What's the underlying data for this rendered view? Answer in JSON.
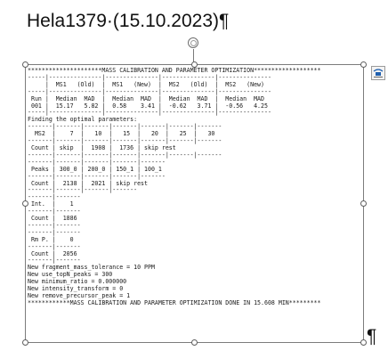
{
  "document": {
    "title": "Hela1379·(15.10.2023)¶",
    "end_mark": "¶"
  },
  "image": {
    "lines": [
      "*********************MASS CALIBRATION AND PARAMETER OPTIMIZATION*******************",
      "-----|---------------|---------------|---------------|---------------",
      "     |  MS1   (Old)  |  MS1   (New)  |  MS2   (Old)  |  MS2   (New)",
      "-----|---------------|---------------|---------------|---------------",
      " Run |  Median  MAD  |  Median  MAD  |  Median  MAD  |  Median  MAD",
      " 001 |  15.17   5.82 |  0.58    3.41 |  -0.62   3.71 |  -0.56   4.25",
      "-----|---------------|---------------|---------------|---------------",
      "Finding the optimal parameters:",
      "-------|-------|-------|-------|-------|-------|-------",
      "  MS2  |    7  |   10  |   15  |   20  |   25  |   30",
      "-------|-------|-------|-------|-------|-------|-------",
      " Count | skip  |  1908 |  1736 | skip rest",
      "-------|-------|-------|-------|-------|-------|-------",
      "-------|-------|-------|-------|-------",
      " Peaks | 300_0 | 200_0 | 150_1 | 100_1",
      "-------|-------|-------|-------|-------",
      " Count |  2138 |  2021 | skip rest",
      "-------|-------|-------|-------",
      "-------|-------",
      " Int.  |    1",
      "-------|-------",
      " Count |  1886",
      "-------|-------",
      "-------|-------",
      " Rm P. |    0",
      "-------|-------",
      " Count |  2056",
      "-------|-------",
      "New fragment_mass_tolerance = 10 PPM",
      "New use_topN_peaks = 300",
      "New minimum_ratio = 0.000000",
      "New intensity_transform = 0",
      "New remove_precursor_peak = 1",
      "************MASS CALIBRATION AND PARAMETER OPTIMIZATION DONE IN 15.608 MIN*********"
    ]
  },
  "icons": {
    "rotate": "rotate-handle-icon",
    "layout_options": "layout-options-icon",
    "selection_handle": "resize-handle-icon"
  },
  "colors": {
    "frame_border": "#7c7c7c",
    "text": "#1a1a1a",
    "handle_border": "#5e5e5e"
  }
}
